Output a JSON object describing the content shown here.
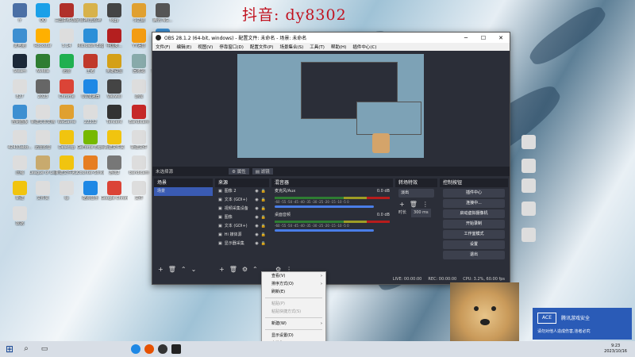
{
  "watermark": "抖音: dy8302",
  "desktop_icons": [
    {
      "label": "fr",
      "color": "#4a6fa5"
    },
    {
      "label": "QQ",
      "color": "#1aa0e8"
    },
    {
      "label": "三国杀移动版",
      "color": "#b0302a"
    },
    {
      "label": "原神/云原神",
      "color": "#d8b24a"
    },
    {
      "label": "fdgy",
      "color": "#444"
    },
    {
      "label": "斗之启",
      "color": "#e0a030"
    },
    {
      "label": "腾讯 NG...",
      "color": "#555"
    },
    {
      "label": "此电脑",
      "color": "#3d8fd1"
    },
    {
      "label": "Rockstar",
      "color": "#ffb000"
    },
    {
      "label": "5.14",
      "color": "#ddd"
    },
    {
      "label": "Microsoft Edge",
      "color": "#2b8fd8"
    },
    {
      "label": "中国麦...",
      "color": "#b41f1f"
    },
    {
      "label": "YY语音",
      "color": "#f39c12"
    },
    {
      "label": "网络",
      "color": "#3d8fd1"
    },
    {
      "label": "Steam",
      "color": "#1b2838"
    },
    {
      "label": "Nvidia",
      "color": "#2e7d32"
    },
    {
      "label": "迅雷",
      "color": "#20b050"
    },
    {
      "label": "王者",
      "color": "#c0392b"
    },
    {
      "label": "英雄联盟",
      "color": "#d4a017"
    },
    {
      "label": "回收站",
      "color": "#8aa"
    },
    {
      "label": "Studio One",
      "color": "#333"
    },
    {
      "label": "827",
      "color": "#ddd"
    },
    {
      "label": "2023",
      "color": "#666"
    },
    {
      "label": "Chrome",
      "color": "#db4437"
    },
    {
      "label": "UU加速器",
      "color": "#1e88e5"
    },
    {
      "label": "Weiwei",
      "color": "#444"
    },
    {
      "label": "游戏",
      "color": "#ddd"
    },
    {
      "label": "kpt8rt",
      "color": "#e67e22"
    },
    {
      "label": "控制面板",
      "color": "#3d8fd1"
    },
    {
      "label": "新建文本文档",
      "color": "#ddd"
    },
    {
      "label": "WeGame",
      "color": "#e0a030"
    },
    {
      "label": "22232",
      "color": "#ddd"
    },
    {
      "label": "Tencent",
      "color": "#333"
    },
    {
      "label": "Bandicam",
      "color": "#c62828"
    },
    {
      "label": "网易云音乐",
      "color": "#c62828"
    },
    {
      "label": "42433abb...",
      "color": "#ddd"
    },
    {
      "label": "迅雷影音",
      "color": "#ddd"
    },
    {
      "label": "Desktop",
      "color": "#f1c40f"
    },
    {
      "label": "GeForce Experience",
      "color": "#76b900"
    },
    {
      "label": "新建文件夹",
      "color": "#f1c40f"
    },
    {
      "label": "新建文件",
      "color": "#ddd"
    },
    {
      "label": "截图",
      "color": "#333"
    },
    {
      "label": "压缩",
      "color": "#ddd"
    },
    {
      "label": "League of Legends",
      "color": "#c8aa6e"
    },
    {
      "label": "新建文件夹2",
      "color": "#f1c40f"
    },
    {
      "label": "Counter-Strike",
      "color": "#e67e22"
    },
    {
      "label": "游戏2",
      "color": "#777"
    },
    {
      "label": "bandicam",
      "color": "#ddd"
    },
    {
      "label": "网易云",
      "color": "#e53935"
    },
    {
      "label": "新建",
      "color": "#f1c40f"
    },
    {
      "label": "文件夹",
      "color": "#ddd"
    },
    {
      "label": "tp",
      "color": "#ddd"
    },
    {
      "label": "酷狗音乐",
      "color": "#1e88e5"
    },
    {
      "label": "Google Chrome",
      "color": "#db4437"
    },
    {
      "label": "文件",
      "color": "#ddd"
    },
    {
      "label": "Recycle",
      "color": "#ddd"
    },
    {
      "label": "数据",
      "color": "#ddd"
    }
  ],
  "obs": {
    "title": "OBS 28.1.2 (64-bit, windows) - 配置文件: 未命名 - 场景: 未命名",
    "menu": [
      "文件(F)",
      "编辑(E)",
      "视图(V)",
      "停靠窗口(D)",
      "配置文件(P)",
      "场景集合(S)",
      "工具(T)",
      "帮助(H)",
      "插件中心(C)"
    ],
    "no_source": "未选择源",
    "props_btn": "属性",
    "filters_btn": "滤镜",
    "scenes": {
      "title": "场景",
      "items": [
        "场景"
      ]
    },
    "sources": {
      "title": "来源",
      "items": [
        "图像 2",
        "文本 (GDI+)",
        "视频采集设备",
        "图像",
        "文本 (GDI+)",
        "Hi 媒体源",
        "显示器采集"
      ]
    },
    "mixer": {
      "title": "混音器",
      "channels": [
        {
          "name": "麦克风/Aux",
          "db": "0.0 dB"
        },
        {
          "name": "桌面音频",
          "db": "0.0 dB"
        }
      ],
      "scale": "-60 -55 -50 -45 -40 -35 -30 -25 -20 -15 -10 -5 0"
    },
    "transitions": {
      "title": "转场特效",
      "type": "淡出",
      "duration_label": "时长",
      "duration": "300 ms"
    },
    "controls": {
      "title": "控制按钮",
      "buttons": [
        "插件中心",
        "连接中...",
        "启动虚拟摄像机",
        "开始录制",
        "工作室模式",
        "设置",
        "退出"
      ]
    },
    "status": {
      "live": "LIVE: 00:00:00",
      "rec": "REC: 00:00:00",
      "cpu": "CPU: 3.2%, 60.00 fps"
    }
  },
  "context_menu": {
    "items": [
      {
        "label": "查看(V)",
        "submenu": true,
        "disabled": false
      },
      {
        "label": "排序方式(O)",
        "submenu": true,
        "disabled": false
      },
      {
        "label": "刷新(E)",
        "submenu": false,
        "disabled": false
      },
      {
        "label": "粘贴(P)",
        "submenu": false,
        "disabled": true
      },
      {
        "label": "粘贴快捷方式(S)",
        "submenu": false,
        "disabled": true
      },
      {
        "label": "新建(W)",
        "submenu": true,
        "disabled": false
      },
      {
        "label": "显示设置(D)",
        "submenu": false,
        "disabled": false
      },
      {
        "label": "个性化(R)",
        "submenu": false,
        "disabled": false
      }
    ]
  },
  "notification": {
    "title": "腾讯游戏安全",
    "text": "请勿对他人造成伤害,违者必究"
  },
  "clock": {
    "time": "9:23",
    "date": "2023/10/16"
  }
}
